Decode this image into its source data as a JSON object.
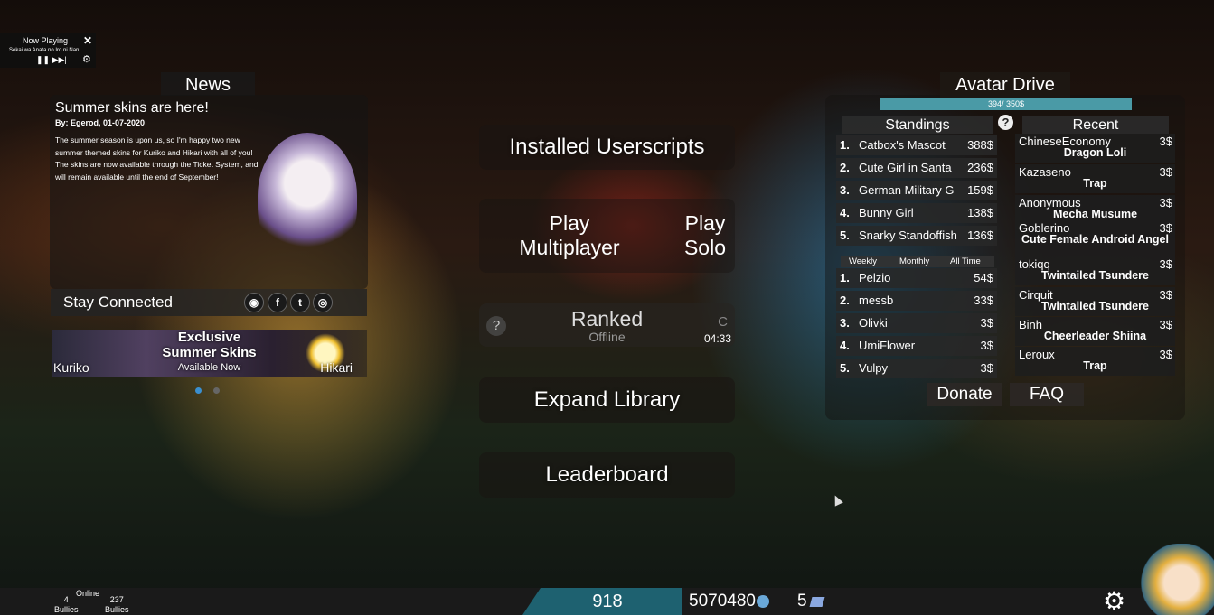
{
  "now_playing": {
    "title": "Now Playing",
    "close": "✕",
    "song": "Sekai wa Anata no Iro ni Naru",
    "controls": "❚❚ ▶▶|",
    "settings_icon": "gear-icon"
  },
  "news": {
    "header": "News",
    "title": "Summer skins are here!",
    "byline": "By: Egerod, 01-07-2020",
    "body1": "The summer season is upon us, so I'm happy two new summer themed skins for Kuriko and Hikari with all of you!",
    "body2": "The skins are now available through the Ticket System, and will remain available until the end of September!"
  },
  "stay_connected": {
    "label": "Stay Connected",
    "icons": [
      "discord-icon",
      "facebook-icon",
      "twitter-icon",
      "globe-icon"
    ]
  },
  "promo": {
    "title_line1": "Exclusive",
    "title_line2": "Summer Skins",
    "subtitle": "Available Now",
    "left_name": "Kuriko",
    "right_name": "Hikari"
  },
  "menu": {
    "installed_userscripts": "Installed Userscripts",
    "play_multiplayer_1": "Play",
    "play_multiplayer_2": "Multiplayer",
    "play_solo_1": "Play",
    "play_solo_2": "Solo",
    "ranked": "Ranked",
    "ranked_status": "Offline",
    "ranked_help": "?",
    "ranked_c": "C",
    "ranked_time": "04:33",
    "expand_library": "Expand Library",
    "leaderboard": "Leaderboard"
  },
  "avatar_drive": {
    "title": "Avatar Drive",
    "progress_text": "394/ 350$",
    "progress_fraction": 1.0,
    "help": "?",
    "standings_title": "Standings",
    "standings": [
      {
        "rank": "1.",
        "name": "Catbox's Mascot",
        "amount": "388$"
      },
      {
        "rank": "2.",
        "name": "Cute Girl in Santa",
        "amount": "236$"
      },
      {
        "rank": "3.",
        "name": "German Military G",
        "amount": "159$"
      },
      {
        "rank": "4.",
        "name": "Bunny Girl",
        "amount": "138$"
      },
      {
        "rank": "5.",
        "name": "Snarky Standoffish",
        "amount": "136$"
      }
    ],
    "tabs": [
      "Weekly",
      "Monthly",
      "All Time"
    ],
    "top_donors": [
      {
        "rank": "1.",
        "name": "Pelzio",
        "amount": "54$"
      },
      {
        "rank": "2.",
        "name": "messb",
        "amount": "33$"
      },
      {
        "rank": "3.",
        "name": "Olivki",
        "amount": "3$"
      },
      {
        "rank": "4.",
        "name": "UmiFlower",
        "amount": "3$"
      },
      {
        "rank": "5.",
        "name": "Vulpy",
        "amount": "3$"
      }
    ],
    "recent_title": "Recent",
    "recent": [
      {
        "user": "ChineseEconomy",
        "amount": "3$",
        "item": "Dragon Loli"
      },
      {
        "user": "Kazaseno",
        "amount": "3$",
        "item": "Trap"
      },
      {
        "user": "Anonymous",
        "amount": "3$",
        "item": "Mecha Musume"
      },
      {
        "user": "Goblerino",
        "amount": "3$",
        "item": "Cute Female Android Angel"
      },
      {
        "user": "tokiqq",
        "amount": "3$",
        "item": "Twintailed Tsundere"
      },
      {
        "user": "Cirquit",
        "amount": "3$",
        "item": "Twintailed Tsundere"
      },
      {
        "user": "Binh",
        "amount": "3$",
        "item": "Cheerleader Shiina"
      },
      {
        "user": "Leroux",
        "amount": "3$",
        "item": "Trap"
      }
    ],
    "donate": "Donate",
    "faq": "FAQ"
  },
  "bottom_bar": {
    "online_label": "Online",
    "online_left_count": "4",
    "online_left_label": "Bullies",
    "online_right_count": "237",
    "online_right_label": "Bullies",
    "level": "918",
    "points": "5070480",
    "tickets": "5",
    "settings_icon": "gear-icon"
  },
  "colors": {
    "accent_teal": "#1e6170",
    "progress_fill": "#4a9aa6",
    "dot_active": "#3a8fd0"
  }
}
